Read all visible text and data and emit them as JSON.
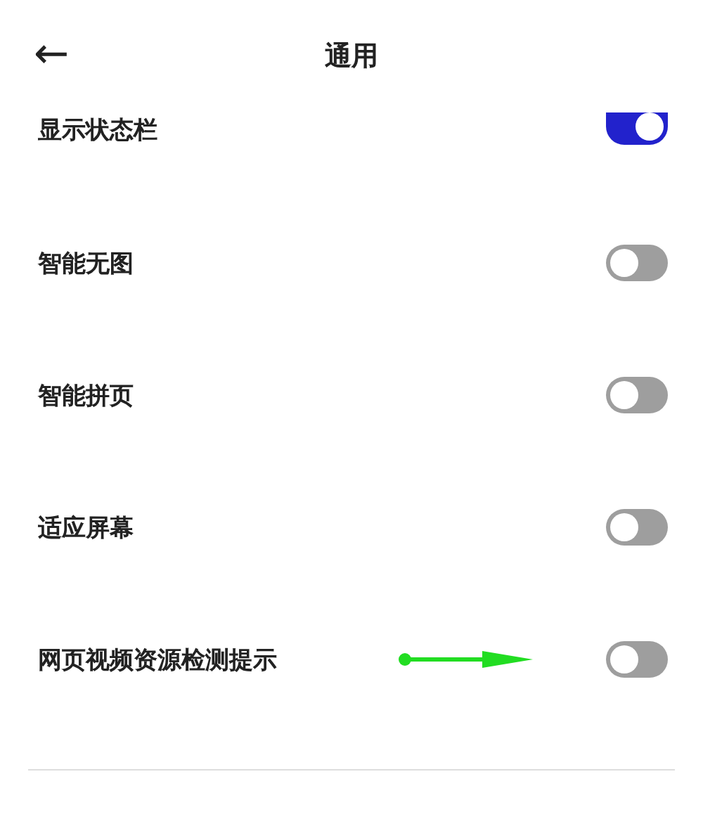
{
  "header": {
    "back": "←",
    "title": "通用"
  },
  "settings": [
    {
      "label": "显示状态栏",
      "on": true,
      "clipped": true,
      "arrow": false
    },
    {
      "label": "智能无图",
      "on": false,
      "clipped": false,
      "arrow": false
    },
    {
      "label": "智能拼页",
      "on": false,
      "clipped": false,
      "arrow": false
    },
    {
      "label": "适应屏幕",
      "on": false,
      "clipped": false,
      "arrow": false
    },
    {
      "label": "网页视频资源检测提示",
      "on": false,
      "clipped": false,
      "arrow": true
    }
  ]
}
